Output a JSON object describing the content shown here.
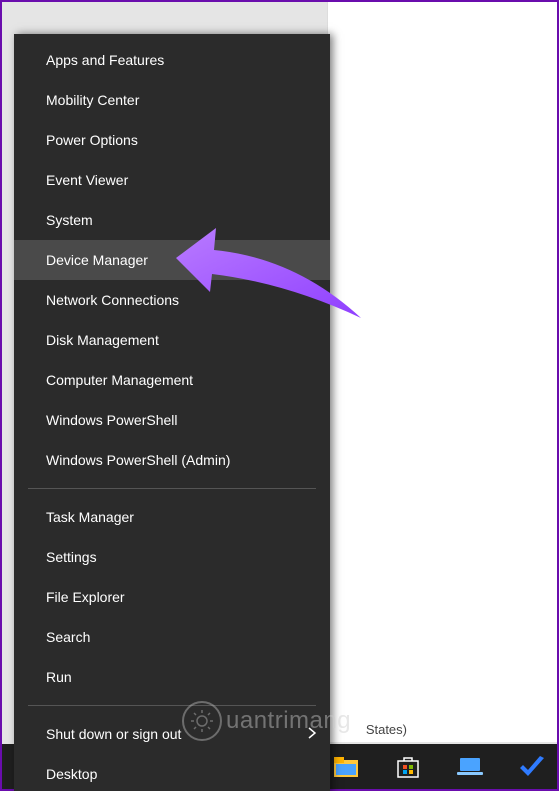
{
  "menu": {
    "groups": [
      [
        {
          "label": "Apps and Features",
          "name": "winx-apps-and-features"
        },
        {
          "label": "Mobility Center",
          "name": "winx-mobility-center"
        },
        {
          "label": "Power Options",
          "name": "winx-power-options"
        },
        {
          "label": "Event Viewer",
          "name": "winx-event-viewer"
        },
        {
          "label": "System",
          "name": "winx-system"
        },
        {
          "label": "Device Manager",
          "name": "winx-device-manager",
          "hovered": true
        },
        {
          "label": "Network Connections",
          "name": "winx-network-connections"
        },
        {
          "label": "Disk Management",
          "name": "winx-disk-management"
        },
        {
          "label": "Computer Management",
          "name": "winx-computer-management"
        },
        {
          "label": "Windows PowerShell",
          "name": "winx-powershell"
        },
        {
          "label": "Windows PowerShell (Admin)",
          "name": "winx-powershell-admin"
        }
      ],
      [
        {
          "label": "Task Manager",
          "name": "winx-task-manager"
        },
        {
          "label": "Settings",
          "name": "winx-settings"
        },
        {
          "label": "File Explorer",
          "name": "winx-file-explorer"
        },
        {
          "label": "Search",
          "name": "winx-search"
        },
        {
          "label": "Run",
          "name": "winx-run"
        }
      ],
      [
        {
          "label": "Shut down or sign out",
          "name": "winx-shutdown",
          "submenu": true
        },
        {
          "label": "Desktop",
          "name": "winx-desktop"
        }
      ]
    ]
  },
  "annotation": {
    "arrow_color": "#a855f7"
  },
  "background": {
    "language_indicator": "States)"
  },
  "taskbar": {
    "icons": [
      {
        "name": "file-explorer-icon",
        "color": "#ffc83d"
      },
      {
        "name": "microsoft-store-icon",
        "color": "#ffffff"
      },
      {
        "name": "laptop-icon",
        "color": "#4aa3ff"
      },
      {
        "name": "checkmark-icon",
        "color": "#2f7bff"
      }
    ]
  },
  "watermark": {
    "text": "uantrimang"
  }
}
